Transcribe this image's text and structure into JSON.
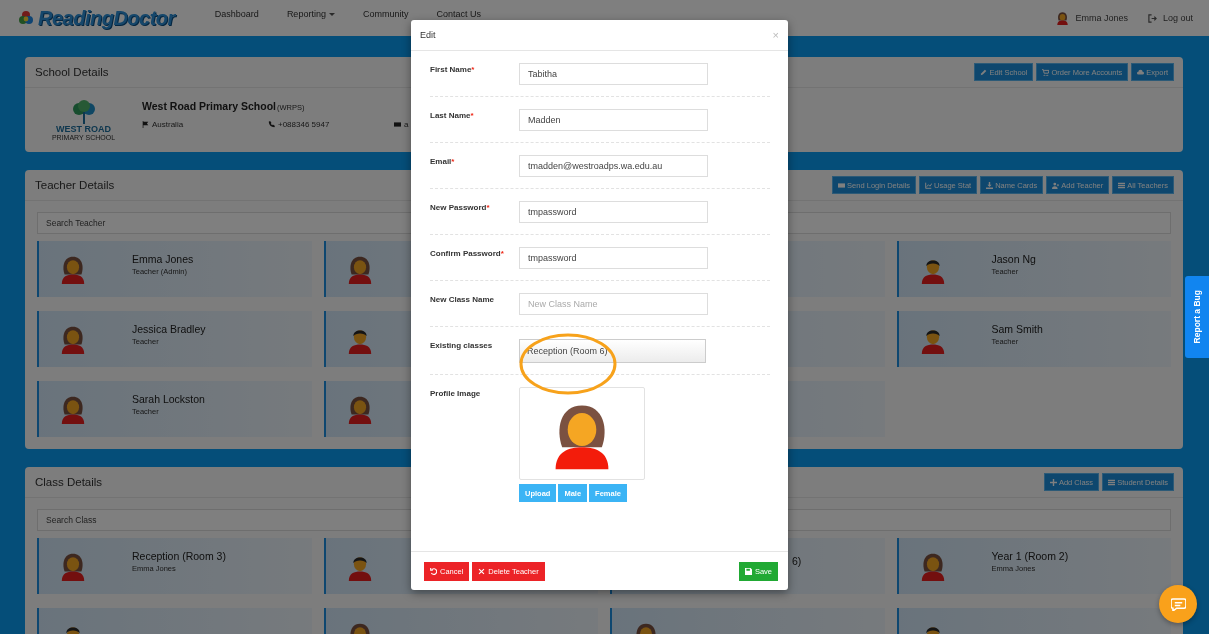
{
  "navbar": {
    "logo": "ReadingDoctor",
    "links": [
      {
        "label": "Dashboard",
        "dropdown": false
      },
      {
        "label": "Reporting",
        "dropdown": true
      },
      {
        "label": "Community",
        "dropdown": false
      },
      {
        "label": "Contact Us",
        "dropdown": false
      }
    ],
    "user": "Emma Jones",
    "logout": "Log out"
  },
  "school_panel": {
    "title": "School Details",
    "buttons": [
      {
        "label": "Edit School"
      },
      {
        "label": "Order More Accounts"
      },
      {
        "label": "Export"
      }
    ],
    "logo_text": "WEST ROAD",
    "logo_subtext": "PRIMARY SCHOOL",
    "name": "West Road Primary School",
    "code": "(WRPS)",
    "details": [
      {
        "text": "Australia"
      },
      {
        "text": "+088346 5947"
      },
      {
        "text": "a"
      }
    ]
  },
  "teacher_panel": {
    "title": "Teacher Details",
    "buttons": [
      {
        "label": "Send Login Details"
      },
      {
        "label": "Usage Stat"
      },
      {
        "label": "Name Cards"
      },
      {
        "label": "Add Teacher"
      },
      {
        "label": "All Teachers"
      }
    ],
    "search_placeholder": "Search Teacher",
    "cards": [
      {
        "name": "Emma Jones",
        "detail": "Teacher (Admin)",
        "kind": "female"
      },
      {
        "kind": "female"
      },
      {
        "kind": "covered"
      },
      {
        "name": "Jason Ng",
        "detail": "Teacher",
        "kind": "male"
      },
      {
        "name": "Jessica Bradley",
        "detail": "Teacher",
        "kind": "female"
      },
      {
        "kind": "male"
      },
      {
        "kind": "covered"
      },
      {
        "name": "Sam Smith",
        "detail": "Teacher",
        "kind": "male"
      },
      {
        "name": "Sarah Lockston",
        "detail": "Teacher",
        "kind": "female"
      },
      {
        "kind": "female"
      },
      {
        "kind": "covered"
      }
    ]
  },
  "class_panel": {
    "title": "Class Details",
    "buttons": [
      {
        "label": "Add Class"
      },
      {
        "label": "Student Details"
      }
    ],
    "search_placeholder": "Search Class",
    "cards": [
      {
        "name": "Reception (Room 3)",
        "detail": "Emma Jones",
        "kind": "female"
      },
      {
        "kind": "male"
      },
      {
        "name": "6)",
        "kind": "covered"
      },
      {
        "name": "Year 1 (Room 2)",
        "detail": "Emma Jones",
        "kind": "female"
      },
      {
        "kind": "male"
      },
      {
        "kind": "female"
      },
      {
        "kind": "female"
      },
      {
        "kind": "male"
      }
    ]
  },
  "dialog": {
    "title": "Edit",
    "close": "×",
    "fields": [
      {
        "label": "First Name",
        "required_mark": "*",
        "kind": "input",
        "value": "Tabitha"
      },
      {
        "label": "Last Name",
        "required_mark": "*",
        "kind": "input",
        "value": "Madden"
      },
      {
        "label": "Email",
        "required_mark": "*",
        "kind": "input",
        "value": "tmadden@westroadps.wa.edu.au"
      },
      {
        "label": "New Password",
        "required_mark": "*",
        "kind": "input",
        "value": "tmpassword"
      },
      {
        "label": "Confirm Password",
        "required_mark": "*",
        "kind": "input",
        "value": "tmpassword"
      },
      {
        "label": "New Class Name",
        "kind": "input",
        "placeholder": "New Class Name"
      },
      {
        "label": "Existing classes",
        "kind": "select",
        "value": "Reception (Room 6)"
      }
    ],
    "profile": {
      "label": "Profile Image",
      "kind": "female",
      "buttons": [
        "Upload",
        "Male",
        "Female"
      ]
    },
    "footer_buttons": [
      {
        "label": "Cancel",
        "kind": "danger"
      },
      {
        "label": "Delete Teacher",
        "kind": "danger"
      },
      {
        "label": "Save",
        "kind": "success"
      }
    ]
  },
  "report_bug": "Report a Bug"
}
